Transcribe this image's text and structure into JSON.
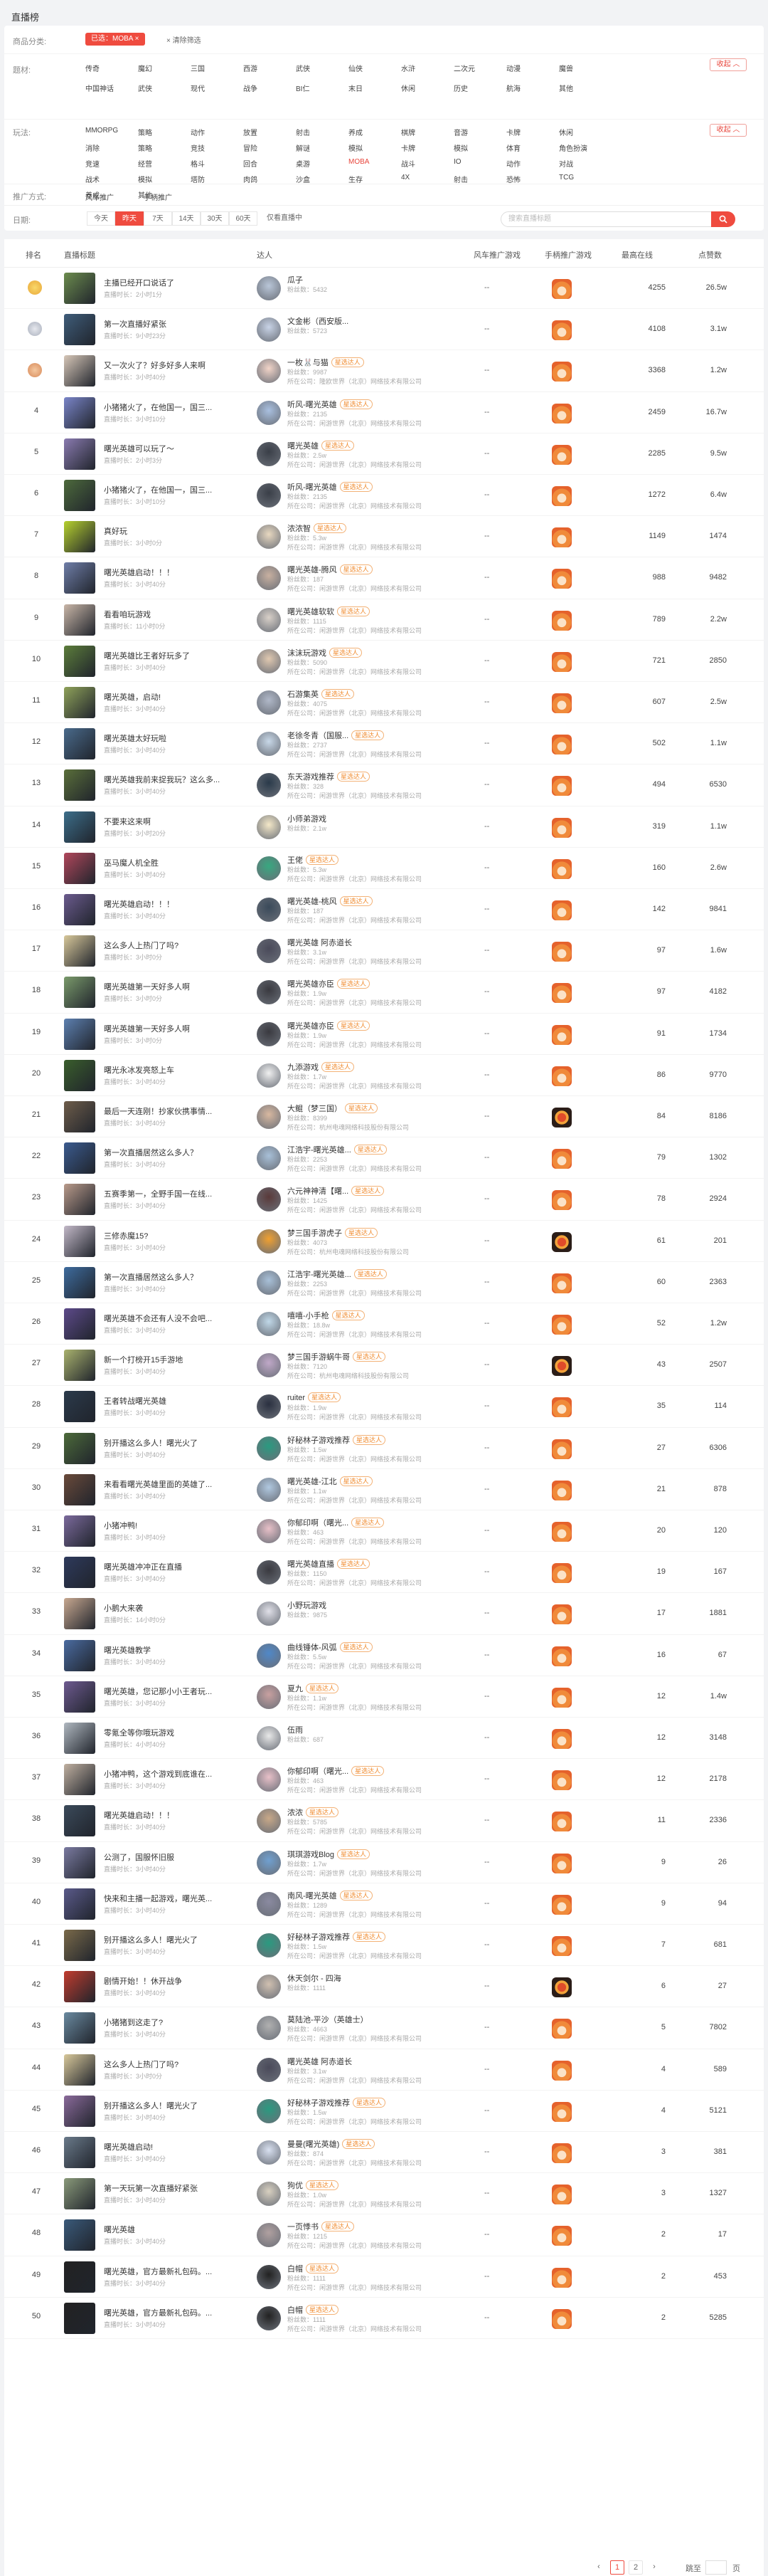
{
  "page_title": "直播榜",
  "filters": {
    "category_label": "商品分类:",
    "selected_chip": "已选：MOBA ×",
    "clear": "× 清除筛选",
    "type_label": "题材:",
    "collapse": "收起 ︿",
    "type_items": [
      "传奇",
      "魔幻",
      "三国",
      "西游",
      "武侠",
      "仙侠",
      "水浒",
      "二次元",
      "动漫",
      "魔兽",
      "中国神话",
      "武侠",
      "现代",
      "战争",
      "BI仁",
      "末日",
      "休闲",
      "历史",
      "航海",
      "其他"
    ],
    "genre_label": "玩法:",
    "genre_items": [
      "MMORPG",
      "策略",
      "动作",
      "放置",
      "射击",
      "养成",
      "棋牌",
      "音游",
      "卡牌",
      "休闲",
      "消除",
      "策略",
      "竞技",
      "冒险",
      "解谜",
      "模拟",
      "卡牌",
      "模拟",
      "体育",
      "角色扮演",
      "竞速",
      "经营",
      "格斗",
      "回合",
      "桌游",
      "MOBA",
      "战斗",
      "IO",
      "动作",
      "对战",
      "战术",
      "模拟",
      "塔防",
      "肉鸽",
      "沙盒",
      "生存",
      "4X",
      "射击",
      "恐怖",
      "TCG",
      "养成",
      "其他"
    ],
    "promo_label": "推广方式:",
    "promo_items": [
      "风车推广",
      "手柄推广"
    ],
    "date_label": "日期:",
    "dates": [
      "今天",
      "昨天",
      "7天",
      "14天",
      "30天",
      "60天",
      "仅看直播中"
    ],
    "search_placeholder": "搜索直播标题"
  },
  "table": {
    "headers": [
      "排名",
      "直播标题",
      "达人",
      "风车推广游戏",
      "手柄推广游戏",
      "最高在线",
      "点赞数"
    ],
    "time_prefix": "直播时长：",
    "fans_prefix": "粉丝数：",
    "company_prefix": "所在公司：",
    "rows": [
      {
        "rank": "1",
        "title": "主播已经开口说话了",
        "time": "2小时1分",
        "anchor": "瓜子",
        "badge": "",
        "fans": "5432",
        "company": "",
        "game": "fox",
        "peak": "4255",
        "likes": "26.5w"
      },
      {
        "rank": "2",
        "title": "第一次直播好紧张",
        "time": "9小时23分",
        "anchor": "文金彬（西安版...",
        "badge": "",
        "fans": "5723",
        "company": "",
        "game": "fox",
        "peak": "4108",
        "likes": "3.1w"
      },
      {
        "rank": "3",
        "title": "又一次火了？好多好多人来啊",
        "time": "3小时40分",
        "anchor": "一枚🐰与猫",
        "badge": "星选达人",
        "fans": "9987",
        "company": "所在公司：隆欧世界（北京）网络技术有限公司",
        "game": "fox",
        "peak": "3368",
        "likes": "1.2w"
      },
      {
        "rank": "4",
        "title": "小猪猪火了，在他国一，国三...",
        "time": "3小时10分",
        "anchor": "听风-曙光英雄",
        "badge": "星选达人",
        "fans": "2135",
        "company": "所在公司：闲游世界（北京）网络技术有限公司",
        "game": "fox",
        "peak": "2459",
        "likes": "16.7w"
      },
      {
        "rank": "5",
        "title": "曙光英雄可以玩了～",
        "time": "2小时3分",
        "anchor": "曙光英雄",
        "badge": "星选达人",
        "fans": "2.5w",
        "company": "所在公司：闲游世界（北京）网络技术有限公司",
        "game": "fox",
        "peak": "2285",
        "likes": "9.5w"
      },
      {
        "rank": "6",
        "title": "小猪猪火了，在他国一，国三...",
        "time": "3小时10分",
        "anchor": "听风-曙光英雄",
        "badge": "星选达人",
        "fans": "2135",
        "company": "所在公司：闲游世界（北京）网络技术有限公司",
        "game": "fox",
        "peak": "1272",
        "likes": "6.4w"
      },
      {
        "rank": "7",
        "title": "真好玩",
        "time": "3小时0分",
        "anchor": "浓浓智",
        "badge": "星选达人",
        "fans": "5.3w",
        "company": "所在公司：闲游世界（北京）网络技术有限公司",
        "game": "fox",
        "peak": "1149",
        "likes": "1474"
      },
      {
        "rank": "8",
        "title": "曙光英雄启动！！！",
        "time": "3小时40分",
        "anchor": "曙光英雄-腾风",
        "badge": "星选达人",
        "fans": "187",
        "company": "所在公司：闲游世界（北京）网络技术有限公司",
        "game": "fox",
        "peak": "988",
        "likes": "9482"
      },
      {
        "rank": "9",
        "title": "看看咱玩游戏",
        "time": "11小时0分",
        "anchor": "曙光英雄软软",
        "badge": "星选达人",
        "fans": "1115",
        "company": "所在公司：闲游世界（北京）网络技术有限公司",
        "game": "fox",
        "peak": "789",
        "likes": "2.2w"
      },
      {
        "rank": "10",
        "title": "曙光英雄比王者好玩多了",
        "time": "3小时40分",
        "anchor": "沫沫玩游戏",
        "badge": "星选达人",
        "fans": "5090",
        "company": "所在公司：闲游世界（北京）网络技术有限公司",
        "game": "fox",
        "peak": "721",
        "likes": "2850"
      },
      {
        "rank": "11",
        "title": "曙光英雄，启动!",
        "time": "3小时40分",
        "anchor": "石游集英",
        "badge": "星选达人",
        "fans": "4075",
        "company": "所在公司：闲游世界（北京）网络技术有限公司",
        "game": "fox",
        "peak": "607",
        "likes": "2.5w"
      },
      {
        "rank": "12",
        "title": "曙光英雄太好玩啦",
        "time": "3小时40分",
        "anchor": "老徐冬青（国服...",
        "badge": "星选达人",
        "fans": "2737",
        "company": "所在公司：闲游世界（北京）网络技术有限公司",
        "game": "fox",
        "peak": "502",
        "likes": "1.1w"
      },
      {
        "rank": "13",
        "title": "曙光英雄我前来捉我玩？这么多...",
        "time": "3小时40分",
        "anchor": "东天游戏推荐",
        "badge": "星选达人",
        "fans": "328",
        "company": "所在公司：闲游世界（北京）网络技术有限公司",
        "game": "fox",
        "peak": "494",
        "likes": "6530"
      },
      {
        "rank": "14",
        "title": "不要来这来啊",
        "time": "3小时20分",
        "anchor": "小师弟游戏",
        "badge": "",
        "fans": "2.1w",
        "company": "",
        "game": "fox",
        "peak": "319",
        "likes": "1.1w"
      },
      {
        "rank": "15",
        "title": "巫马魔人机全胜",
        "time": "3小时40分",
        "anchor": "王佬",
        "badge": "星选达人",
        "fans": "5.3w",
        "company": "所在公司：闲游世界（北京）网络技术有限公司",
        "game": "fox",
        "peak": "160",
        "likes": "2.6w"
      },
      {
        "rank": "16",
        "title": "曙光英雄启动！！！",
        "time": "3小时40分",
        "anchor": "曙光英雄-桃风",
        "badge": "星选达人",
        "fans": "187",
        "company": "所在公司：闲游世界（北京）网络技术有限公司",
        "game": "fox",
        "peak": "142",
        "likes": "9841"
      },
      {
        "rank": "17",
        "title": "这么多人上热门了吗?",
        "time": "3小时0分",
        "anchor": "曙光英雄 阿赤道长",
        "badge": "",
        "fans": "3.1w",
        "company": "所在公司：闲游世界（北京）网络技术有限公司",
        "game": "fox",
        "peak": "97",
        "likes": "1.6w"
      },
      {
        "rank": "18",
        "title": "曙光英雄第一天好多人啊",
        "time": "3小时0分",
        "anchor": "曙光英雄亦臣",
        "badge": "星选达人",
        "fans": "1.9w",
        "company": "所在公司：闲游世界（北京）网络技术有限公司",
        "game": "fox",
        "peak": "97",
        "likes": "4182"
      },
      {
        "rank": "19",
        "title": "曙光英雄第一天好多人啊",
        "time": "3小时0分",
        "anchor": "曙光英雄亦臣",
        "badge": "星选达人",
        "fans": "1.9w",
        "company": "所在公司：闲游世界（北京）网络技术有限公司",
        "game": "fox",
        "peak": "91",
        "likes": "1734"
      },
      {
        "rank": "20",
        "title": "曙光永冰发亮怒上车",
        "time": "3小时40分",
        "anchor": "九添游戏",
        "badge": "星选达人",
        "fans": "1.7w",
        "company": "所在公司：闲游世界（北京）网络技术有限公司",
        "game": "fox",
        "peak": "86",
        "likes": "9770"
      },
      {
        "rank": "21",
        "title": "最后一天连刚！抄家伙携事情...",
        "time": "3小时40分",
        "anchor": "大鲲（梦三国）",
        "badge": "星选达人",
        "fans": "8399",
        "company": "所在公司：杭州电魂网络科技股份有限公司",
        "game": "dark",
        "peak": "84",
        "likes": "8186"
      },
      {
        "rank": "22",
        "title": "第一次直播居然这么多人？",
        "time": "3小时40分",
        "anchor": "江浩宇-曙光英雄...",
        "badge": "星选达人",
        "fans": "2253",
        "company": "所在公司：闲游世界（北京）网络技术有限公司",
        "game": "fox",
        "peak": "79",
        "likes": "1302"
      },
      {
        "rank": "23",
        "title": "五赛季第一，全野手国一在线...",
        "time": "3小时40分",
        "anchor": "六元神神清【曙...",
        "badge": "星选达人",
        "fans": "1425",
        "company": "所在公司：闲游世界（北京）网络技术有限公司",
        "game": "fox",
        "peak": "78",
        "likes": "2924"
      },
      {
        "rank": "24",
        "title": "三修赤魔15?",
        "time": "3小时40分",
        "anchor": "梦三国手游虎子",
        "badge": "星选达人",
        "fans": "4073",
        "company": "所在公司：杭州电魂网络科技股份有限公司",
        "game": "dark",
        "peak": "61",
        "likes": "201"
      },
      {
        "rank": "25",
        "title": "第一次直播居然这么多人？",
        "time": "3小时40分",
        "anchor": "江浩宇-曙光英雄...",
        "badge": "星选达人",
        "fans": "2253",
        "company": "所在公司：闲游世界（北京）网络技术有限公司",
        "game": "fox",
        "peak": "60",
        "likes": "2363"
      },
      {
        "rank": "26",
        "title": "曙光英雄不会还有人没不会吧...",
        "time": "3小时40分",
        "anchor": "嘻嘻-小手枪",
        "badge": "星选达人",
        "fans": "18.8w",
        "company": "所在公司：闲游世界（北京）网络技术有限公司",
        "game": "fox",
        "peak": "52",
        "likes": "1.2w"
      },
      {
        "rank": "27",
        "title": "新一个打榜开15手游地",
        "time": "3小时40分",
        "anchor": "梦三国手游蜗牛哥",
        "badge": "星选达人",
        "fans": "7120",
        "company": "所在公司：杭州电魂网络科技股份有限公司",
        "game": "dark",
        "peak": "43",
        "likes": "2507"
      },
      {
        "rank": "28",
        "title": "王者转战曙光英雄",
        "time": "3小时40分",
        "anchor": "ruiter",
        "badge": "星选达人",
        "fans": "1.9w",
        "company": "所在公司：闲游世界（北京）网络技术有限公司",
        "game": "fox",
        "peak": "35",
        "likes": "114"
      },
      {
        "rank": "29",
        "title": "别开播这么多人！曙光火了",
        "time": "3小时40分",
        "anchor": "好秘林子游戏推荐",
        "badge": "星选达人",
        "fans": "1.5w",
        "company": "所在公司：闲游世界（北京）网络技术有限公司",
        "game": "fox",
        "peak": "27",
        "likes": "6306"
      },
      {
        "rank": "30",
        "title": "来看看曙光英雄里面的英雄了...",
        "time": "3小时40分",
        "anchor": "曙光英雄-江北",
        "badge": "星选达人",
        "fans": "1.1w",
        "company": "所在公司：闲游世界（北京）网络技术有限公司",
        "game": "fox",
        "peak": "21",
        "likes": "878"
      },
      {
        "rank": "31",
        "title": "小猪冲鸭!",
        "time": "3小时40分",
        "anchor": "你郁印啊（曙光...",
        "badge": "星选达人",
        "fans": "463",
        "company": "所在公司：闲游世界（北京）网络技术有限公司",
        "game": "fox",
        "peak": "20",
        "likes": "120"
      },
      {
        "rank": "32",
        "title": "曙光英雄冲冲正在直播",
        "time": "3小时40分",
        "anchor": "曙光英雄直播",
        "badge": "星选达人",
        "fans": "1150",
        "company": "所在公司：闲游世界（北京）网络技术有限公司",
        "game": "fox",
        "peak": "19",
        "likes": "167"
      },
      {
        "rank": "33",
        "title": "小鹅大来袭",
        "time": "14小时0分",
        "anchor": "小野玩游戏",
        "badge": "",
        "fans": "9875",
        "company": "",
        "game": "fox",
        "peak": "17",
        "likes": "1881"
      },
      {
        "rank": "34",
        "title": "曙光英雄教学",
        "time": "3小时40分",
        "anchor": "曲线锤体-风弧",
        "badge": "星选达人",
        "fans": "5.5w",
        "company": "所在公司：闲游世界（北京）网络技术有限公司",
        "game": "fox",
        "peak": "16",
        "likes": "67"
      },
      {
        "rank": "35",
        "title": "曙光英雄，您记那小小王者玩...",
        "time": "3小时40分",
        "anchor": "夏九",
        "badge": "星选达人",
        "fans": "1.1w",
        "company": "所在公司：闲游世界（北京）网络技术有限公司",
        "game": "fox",
        "peak": "12",
        "likes": "1.4w"
      },
      {
        "rank": "36",
        "title": "零氪全等你哦玩游戏",
        "time": "4小时40分",
        "anchor": "伍雨",
        "badge": "",
        "fans": "687",
        "company": "",
        "game": "fox",
        "peak": "12",
        "likes": "3148"
      },
      {
        "rank": "37",
        "title": "小猪冲鸭，这个游戏到底谁在...",
        "time": "3小时40分",
        "anchor": "你郁印啊（曙光...",
        "badge": "星选达人",
        "fans": "463",
        "company": "所在公司：闲游世界（北京）网络技术有限公司",
        "game": "fox",
        "peak": "12",
        "likes": "2178"
      },
      {
        "rank": "38",
        "title": "曙光英雄启动！！！",
        "time": "3小时40分",
        "anchor": "浓浓",
        "badge": "星选达人",
        "fans": "5785",
        "company": "所在公司：闲游世界（北京）网络技术有限公司",
        "game": "fox",
        "peak": "11",
        "likes": "2336"
      },
      {
        "rank": "39",
        "title": "公测了，国服怀旧服",
        "time": "3小时40分",
        "anchor": "琪琪游戏Blog",
        "badge": "星选达人",
        "fans": "1.7w",
        "company": "所在公司：闲游世界（北京）网络技术有限公司",
        "game": "fox",
        "peak": "9",
        "likes": "26"
      },
      {
        "rank": "40",
        "title": "快来和主播一起游戏，曙光英...",
        "time": "3小时40分",
        "anchor": "南风-曙光英雄",
        "badge": "星选达人",
        "fans": "1289",
        "company": "所在公司：闲游世界（北京）网络技术有限公司",
        "game": "fox",
        "peak": "9",
        "likes": "94"
      },
      {
        "rank": "41",
        "title": "别开播这么多人！曙光火了",
        "time": "3小时40分",
        "anchor": "好秘林子游戏推荐",
        "badge": "星选达人",
        "fans": "1.5w",
        "company": "所在公司：闲游世界（北京）网络技术有限公司",
        "game": "fox",
        "peak": "7",
        "likes": "681"
      },
      {
        "rank": "42",
        "title": "剧情开始！！休开战争",
        "time": "3小时40分",
        "anchor": "休天剑尔 - 四海",
        "badge": "",
        "fans": "1111",
        "company": "",
        "game": "dark",
        "peak": "6",
        "likes": "27"
      },
      {
        "rank": "43",
        "title": "小猪猪到这走了?",
        "time": "3小时40分",
        "anchor": "莫陆池-平沙（英雄士）",
        "badge": "",
        "fans": "4663",
        "company": "所在公司：闲游世界（北京）网络技术有限公司",
        "game": "fox",
        "peak": "5",
        "likes": "7802"
      },
      {
        "rank": "44",
        "title": "这么多人上热门了吗?",
        "time": "3小时0分",
        "anchor": "曙光英雄 阿赤道长",
        "badge": "",
        "fans": "3.1w",
        "company": "所在公司：闲游世界（北京）网络技术有限公司",
        "game": "fox",
        "peak": "4",
        "likes": "589"
      },
      {
        "rank": "45",
        "title": "别开播这么多人！曙光火了",
        "time": "3小时40分",
        "anchor": "好秘林子游戏推荐",
        "badge": "星选达人",
        "fans": "1.5w",
        "company": "所在公司：闲游世界（北京）网络技术有限公司",
        "game": "fox",
        "peak": "4",
        "likes": "5121"
      },
      {
        "rank": "46",
        "title": "曙光英雄启动!",
        "time": "3小时40分",
        "anchor": "曼曼(曙光英雄)",
        "badge": "星选达人",
        "fans": "874",
        "company": "所在公司：闲游世界（北京）网络技术有限公司",
        "game": "fox",
        "peak": "3",
        "likes": "381"
      },
      {
        "rank": "47",
        "title": "第一天玩第一次直播好紧张",
        "time": "3小时40分",
        "anchor": "狗优",
        "badge": "星选达人",
        "fans": "1.0w",
        "company": "所在公司：闲游世界（北京）网络技术有限公司",
        "game": "fox",
        "peak": "3",
        "likes": "1327"
      },
      {
        "rank": "48",
        "title": "曙光英雄",
        "time": "3小时40分",
        "anchor": "一页悸书",
        "badge": "星选达人",
        "fans": "1215",
        "company": "所在公司：闲游世界（北京）网络技术有限公司",
        "game": "fox",
        "peak": "2",
        "likes": "17"
      },
      {
        "rank": "49",
        "title": "曙光英雄，官方最新礼包码。...",
        "time": "3小时40分",
        "anchor": "白帽",
        "badge": "星选达人",
        "fans": "1111",
        "company": "所在公司：闲游世界（北京）网络技术有限公司",
        "game": "fox",
        "peak": "2",
        "likes": "453"
      },
      {
        "rank": "50",
        "title": "曙光英雄，官方最新礼包码。...",
        "time": "3小时40分",
        "anchor": "白帽",
        "badge": "星选达人",
        "fans": "1111",
        "company": "所在公司：闲游世界（北京）网络技术有限公司",
        "game": "fox",
        "peak": "2",
        "likes": "5285"
      }
    ]
  },
  "pagination": {
    "prev": "‹",
    "pages": [
      "1",
      "2"
    ],
    "next": "›",
    "goto": "跳至",
    "unit": "页"
  },
  "colors": {
    "accent": "#ef4b3f",
    "badge": "#f08a2c"
  }
}
